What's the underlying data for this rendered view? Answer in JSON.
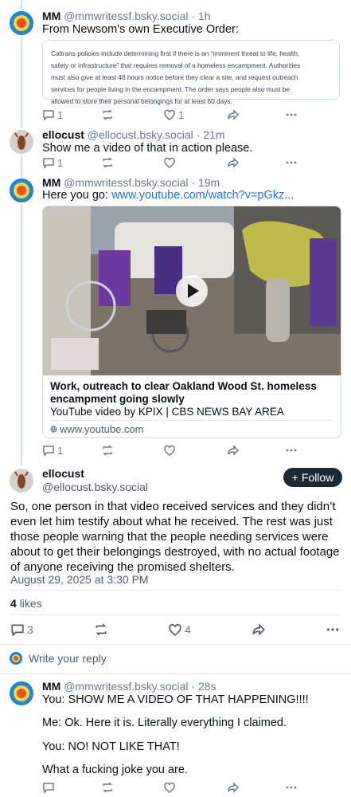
{
  "posts": [
    {
      "name": "MM",
      "handle": "@mmwritessf.bsky.social",
      "time": "· 1h",
      "text": "From Newsom's own Executive Order:",
      "quote_lines": [
        "Caltrans policies include determining first if there is an “imminent threat to life, health,",
        "safety or infrastructure” that requires removal of a homeless encampment. Authorities",
        "must also give at least 48 hours notice before they clear a site, and request outreach",
        "services for people living in the encampment. The order says people also must be",
        "allowed to store their personal belongings for at least 60 days."
      ],
      "reply_count": "1",
      "repost_count": "",
      "like_count": "1"
    },
    {
      "name": "ellocust",
      "handle": "@ellocust.bsky.social",
      "time": "· 21m",
      "text": "Show me a video of that in action please.",
      "reply_count": "1",
      "repost_count": "",
      "like_count": ""
    },
    {
      "name": "MM",
      "handle": "@mmwritessf.bsky.social",
      "time": "· 19m",
      "text": "Here you go: ",
      "link": "www.youtube.com/watch?v=pGkz...",
      "embed": {
        "title": "Work, outreach to clear Oakland Wood St. homeless encampment going slowly",
        "description": "YouTube video by KPIX | CBS NEWS BAY AREA",
        "domain": "www.youtube.com"
      },
      "reply_count": "1",
      "repost_count": "",
      "like_count": ""
    }
  ],
  "main_post": {
    "name": "ellocust",
    "handle": "@ellocust.bsky.social",
    "follow_label": "Follow",
    "text": "So, one person in that video received services and they didn’t even let him testify about what he received. The rest was just those people warning that the people needing services were about to get their belongings destroyed, with no actual footage of anyone receiving the promised shelters.",
    "date": "August 29, 2025 at 3:30 PM",
    "likes_count": "4",
    "likes_label": "likes",
    "reply_count": "3",
    "repost_count": "",
    "like_count": "4"
  },
  "reply_prompt": "Write your reply",
  "reply": {
    "name": "MM",
    "handle": "@mmwritessf.bsky.social",
    "time": "· 28s",
    "lines": [
      "You: SHOW ME A VIDEO OF THAT HAPPENING!!!!",
      "Me: Ok. Here it is. Literally everything I claimed.",
      "You: NO! NOT LIKE THAT!",
      "What a fucking joke you are."
    ]
  },
  "colors": {
    "accent": "#1d74d8",
    "muted": "#6a7a8c",
    "follow_bg": "#1e2936"
  }
}
